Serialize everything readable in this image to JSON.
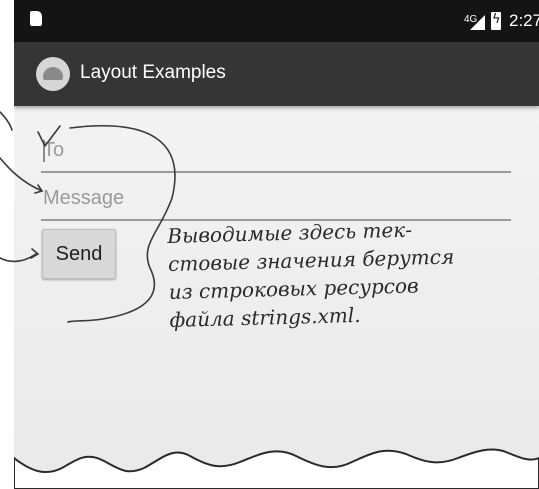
{
  "status_bar": {
    "network": "4G",
    "time": "2:27"
  },
  "app_bar": {
    "title": "Layout Examples"
  },
  "form": {
    "to_placeholder": "To",
    "message_placeholder": "Message",
    "send_label": "Send"
  },
  "annotation": {
    "lines": [
      "Выводимые здесь тек-",
      "стовые значения берутся",
      "из строковых ресурсов",
      "файла strings.xml."
    ]
  },
  "icons": [
    "sd-card-icon",
    "signal-icon",
    "battery-icon",
    "android-app-icon"
  ]
}
